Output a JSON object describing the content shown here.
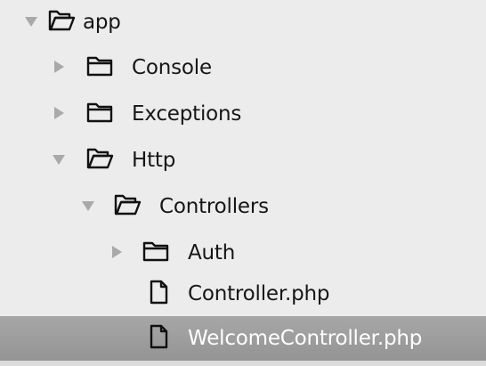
{
  "tree": {
    "items": [
      {
        "label": "app",
        "kind": "folder",
        "state": "expanded"
      },
      {
        "label": "Console",
        "kind": "folder",
        "state": "collapsed"
      },
      {
        "label": "Exceptions",
        "kind": "folder",
        "state": "collapsed"
      },
      {
        "label": "Http",
        "kind": "folder",
        "state": "expanded"
      },
      {
        "label": "Controllers",
        "kind": "folder",
        "state": "expanded"
      },
      {
        "label": "Auth",
        "kind": "folder",
        "state": "collapsed"
      },
      {
        "label": "Controller.php",
        "kind": "file"
      },
      {
        "label": "WelcomeController.php",
        "kind": "file",
        "selected": true
      }
    ]
  },
  "colors": {
    "background": "#ececec",
    "selection": "#9e9e9e",
    "text": "#161616",
    "selected_text": "#ffffff",
    "disclosure": "#a9a9a9",
    "icon_stroke": "#111111"
  },
  "icons": {
    "expanded_disclosure": "triangle-down-icon",
    "collapsed_disclosure": "triangle-right-icon",
    "open_folder": "folder-open-icon",
    "closed_folder": "folder-icon",
    "file": "file-icon"
  }
}
